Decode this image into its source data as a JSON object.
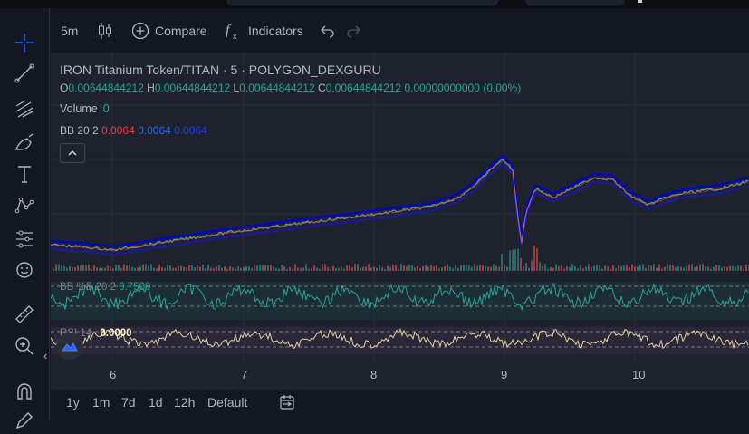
{
  "toolbar": {
    "interval": "5m",
    "compare_label": "Compare",
    "indicators_label": "Indicators"
  },
  "legend": {
    "symbol": "IRON Titanium Token/TITAN · 5 · POLYGON_DEXGURU",
    "ohlc": {
      "o_label": "O",
      "o": "0.00644844212",
      "h_label": "H",
      "h": "0.00644844212",
      "l_label": "L",
      "l": "0.00644844212",
      "c_label": "C",
      "c": "0.00644844212",
      "change": "0.00000000000 (0.00%)"
    },
    "volume_label": "Volume",
    "volume_value": "0",
    "bb_label": "BB 20 2",
    "bb_values": [
      "0.0064",
      "0.0064",
      "0.0064"
    ]
  },
  "panes": {
    "bbpct_label": "BB %B 20 2",
    "bbpct_value": "0.7500",
    "rsi_label": "RSI 14",
    "rsi_value": "0.0000"
  },
  "x_axis": {
    "ticks": [
      "6",
      "7",
      "8",
      "9",
      "10"
    ]
  },
  "bottom_bar": {
    "ranges": [
      "1y",
      "1m",
      "7d",
      "1d",
      "12h"
    ],
    "default_label": "Default"
  },
  "colors": {
    "background": "#131722",
    "pane": "#1e222d",
    "upper_band": "#f23645",
    "basis": "#2962ff",
    "lower_band": "#0000cc",
    "price": "#2fb5b0",
    "bbpct": "#26a69a",
    "rsi": "#e6d19a"
  },
  "icons": {
    "sidebar": [
      "crosshair-icon",
      "trend-line-icon",
      "fib-icon",
      "brush-icon",
      "text-icon",
      "pattern-icon",
      "measure-icon",
      "emoji-icon",
      "ruler-icon",
      "zoom-in-icon",
      "magnet-icon",
      "pencil-icon"
    ],
    "toolbar": [
      "candles-icon",
      "compare-plus-icon",
      "fx-icon",
      "undo-icon",
      "redo-icon"
    ]
  }
}
